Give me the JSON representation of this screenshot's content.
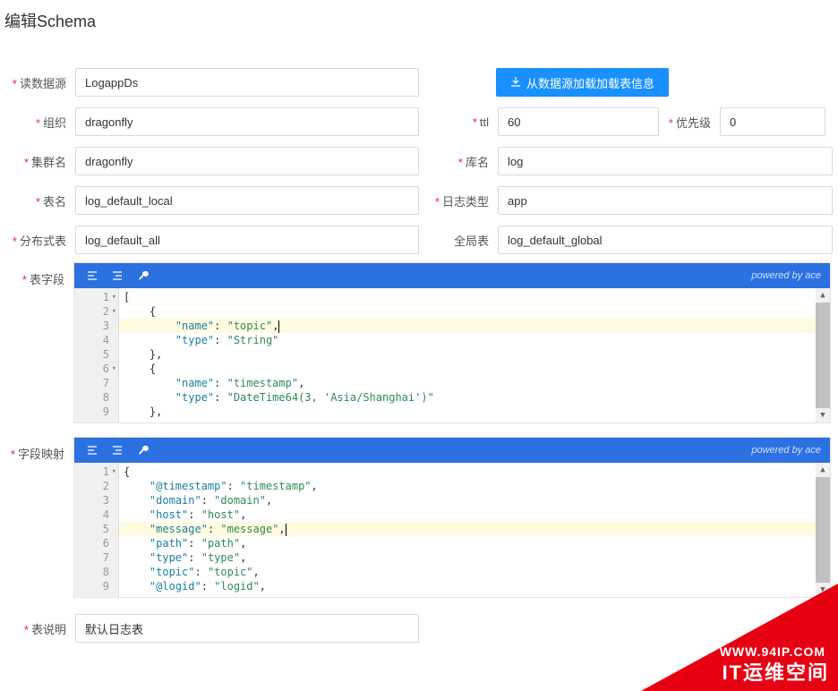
{
  "title": "编辑Schema",
  "labels": {
    "datasource": "读数据源",
    "org": "组织",
    "ttl": "ttl",
    "priority": "优先级",
    "cluster": "集群名",
    "dbname": "库名",
    "table": "表名",
    "logtype": "日志类型",
    "dist_table": "分布式表",
    "global_table": "全局表",
    "fields": "表字段",
    "mapping": "字段映射",
    "description": "表说明"
  },
  "values": {
    "datasource": "LogappDs",
    "org": "dragonfly",
    "ttl": "60",
    "priority": "0",
    "cluster": "dragonfly",
    "dbname": "log",
    "table": "log_default_local",
    "logtype": "app",
    "dist_table": "log_default_all",
    "global_table": "log_default_global",
    "description": "默认日志表"
  },
  "buttons": {
    "load_table": "从数据源加载加载表信息"
  },
  "editor": {
    "powered": "powered by ace",
    "fields_code": [
      {
        "n": 1,
        "fold": true,
        "tokens": [
          {
            "t": "[",
            "c": "k-punc"
          }
        ]
      },
      {
        "n": 2,
        "fold": true,
        "indent": 1,
        "tokens": [
          {
            "t": "{",
            "c": "k-punc"
          }
        ]
      },
      {
        "n": 3,
        "hl": true,
        "indent": 2,
        "tokens": [
          {
            "t": "\"name\"",
            "c": "k-key"
          },
          {
            "t": ": ",
            "c": "k-punc"
          },
          {
            "t": "\"topic\"",
            "c": "k-str"
          },
          {
            "t": ",",
            "c": "k-punc"
          }
        ]
      },
      {
        "n": 4,
        "indent": 2,
        "tokens": [
          {
            "t": "\"type\"",
            "c": "k-key"
          },
          {
            "t": ": ",
            "c": "k-punc"
          },
          {
            "t": "\"String\"",
            "c": "k-str"
          }
        ]
      },
      {
        "n": 5,
        "indent": 1,
        "tokens": [
          {
            "t": "},",
            "c": "k-punc"
          }
        ]
      },
      {
        "n": 6,
        "fold": true,
        "indent": 1,
        "tokens": [
          {
            "t": "{",
            "c": "k-punc"
          }
        ]
      },
      {
        "n": 7,
        "indent": 2,
        "tokens": [
          {
            "t": "\"name\"",
            "c": "k-key"
          },
          {
            "t": ": ",
            "c": "k-punc"
          },
          {
            "t": "\"timestamp\"",
            "c": "k-str"
          },
          {
            "t": ",",
            "c": "k-punc"
          }
        ]
      },
      {
        "n": 8,
        "indent": 2,
        "tokens": [
          {
            "t": "\"type\"",
            "c": "k-key"
          },
          {
            "t": ": ",
            "c": "k-punc"
          },
          {
            "t": "\"DateTime64(3, 'Asia/Shanghai')\"",
            "c": "k-str"
          }
        ]
      },
      {
        "n": 9,
        "indent": 1,
        "tokens": [
          {
            "t": "},",
            "c": "k-punc"
          }
        ]
      }
    ],
    "mapping_code": [
      {
        "n": 1,
        "fold": true,
        "tokens": [
          {
            "t": "{",
            "c": "k-punc"
          }
        ]
      },
      {
        "n": 2,
        "indent": 1,
        "tokens": [
          {
            "t": "\"@timestamp\"",
            "c": "k-key"
          },
          {
            "t": ": ",
            "c": "k-punc"
          },
          {
            "t": "\"timestamp\"",
            "c": "k-str"
          },
          {
            "t": ",",
            "c": "k-punc"
          }
        ]
      },
      {
        "n": 3,
        "indent": 1,
        "tokens": [
          {
            "t": "\"domain\"",
            "c": "k-key"
          },
          {
            "t": ": ",
            "c": "k-punc"
          },
          {
            "t": "\"domain\"",
            "c": "k-str"
          },
          {
            "t": ",",
            "c": "k-punc"
          }
        ]
      },
      {
        "n": 4,
        "indent": 1,
        "tokens": [
          {
            "t": "\"host\"",
            "c": "k-key"
          },
          {
            "t": ": ",
            "c": "k-punc"
          },
          {
            "t": "\"host\"",
            "c": "k-str"
          },
          {
            "t": ",",
            "c": "k-punc"
          }
        ]
      },
      {
        "n": 5,
        "hl": true,
        "indent": 1,
        "tokens": [
          {
            "t": "\"message\"",
            "c": "k-key"
          },
          {
            "t": ": ",
            "c": "k-punc"
          },
          {
            "t": "\"message\"",
            "c": "k-str"
          },
          {
            "t": ",",
            "c": "k-punc"
          }
        ]
      },
      {
        "n": 6,
        "indent": 1,
        "tokens": [
          {
            "t": "\"path\"",
            "c": "k-key"
          },
          {
            "t": ": ",
            "c": "k-punc"
          },
          {
            "t": "\"path\"",
            "c": "k-str"
          },
          {
            "t": ",",
            "c": "k-punc"
          }
        ]
      },
      {
        "n": 7,
        "indent": 1,
        "tokens": [
          {
            "t": "\"type\"",
            "c": "k-key"
          },
          {
            "t": ": ",
            "c": "k-punc"
          },
          {
            "t": "\"type\"",
            "c": "k-str"
          },
          {
            "t": ",",
            "c": "k-punc"
          }
        ]
      },
      {
        "n": 8,
        "indent": 1,
        "tokens": [
          {
            "t": "\"topic\"",
            "c": "k-key"
          },
          {
            "t": ": ",
            "c": "k-punc"
          },
          {
            "t": "\"topic\"",
            "c": "k-str"
          },
          {
            "t": ",",
            "c": "k-punc"
          }
        ]
      },
      {
        "n": 9,
        "indent": 1,
        "tokens": [
          {
            "t": "\"@logid\"",
            "c": "k-key"
          },
          {
            "t": ": ",
            "c": "k-punc"
          },
          {
            "t": "\"logid\"",
            "c": "k-str"
          },
          {
            "t": ",",
            "c": "k-punc"
          }
        ]
      }
    ]
  },
  "badge": {
    "line1": "WWW.94IP.COM",
    "line2": "IT运维空间"
  }
}
